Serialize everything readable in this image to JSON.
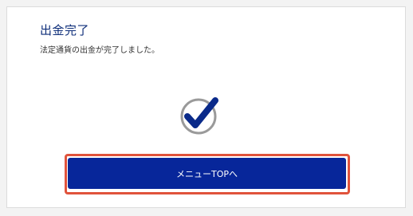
{
  "page": {
    "title": "出金完了",
    "message": "法定通貨の出金が完了しました。"
  },
  "status_icon": {
    "name": "check-circle-icon",
    "circle_color": "#9a9a9a",
    "check_color": "#0a2a8a"
  },
  "actions": {
    "menu_top_label": "メニューTOPへ",
    "menu_top_color": "#07269a",
    "highlight_color": "#e0533c"
  }
}
